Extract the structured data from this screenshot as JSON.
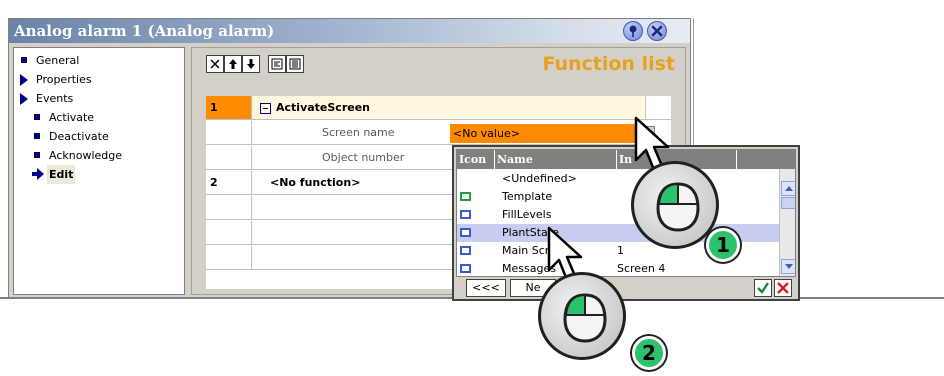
{
  "window": {
    "title": "Analog alarm 1 (Analog alarm)"
  },
  "nav": {
    "items": [
      {
        "label": "General",
        "level": 0,
        "marker": "bullet"
      },
      {
        "label": "Properties",
        "level": 0,
        "marker": "triangle"
      },
      {
        "label": "Events",
        "level": 0,
        "marker": "triangle"
      },
      {
        "label": "Activate",
        "level": 1,
        "marker": "bullet"
      },
      {
        "label": "Deactivate",
        "level": 1,
        "marker": "bullet"
      },
      {
        "label": "Acknowledge",
        "level": 1,
        "marker": "bullet"
      },
      {
        "label": "Edit",
        "level": 1,
        "marker": "arrow",
        "selected": true
      }
    ]
  },
  "function_list": {
    "title": "Function list",
    "toolbar": [
      "delete-icon",
      "move-up-icon",
      "move-down-icon",
      "insert-icon",
      "list-icon"
    ],
    "rows": [
      {
        "num": "1",
        "function": "ActivateScreen"
      },
      {
        "param": "Screen name",
        "value": "<No value>"
      },
      {
        "param": "Object number"
      },
      {
        "num": "2",
        "function": "<No function>"
      }
    ]
  },
  "popup": {
    "headers": {
      "icon": "Icon",
      "name": "Name",
      "extra": "In"
    },
    "items": [
      {
        "name": "<Undefined>",
        "icon": "none"
      },
      {
        "name": "Template",
        "icon": "green"
      },
      {
        "name": "FillLevels",
        "icon": "blue"
      },
      {
        "name": "PlantState",
        "icon": "blue",
        "selected": true
      },
      {
        "name": "Main Scree",
        "extra": "1",
        "icon": "blue"
      },
      {
        "name": "Messages",
        "extra": "Screen 4",
        "icon": "blue"
      }
    ],
    "buttons": {
      "prev": "<<<",
      "next": "Ne"
    }
  },
  "callouts": [
    "1",
    "2"
  ],
  "colors": {
    "accent_orange": "#ff8c00",
    "title_orange": "#e8a020",
    "badge_green": "#2cc26b",
    "selection": "#c8ccf0"
  }
}
